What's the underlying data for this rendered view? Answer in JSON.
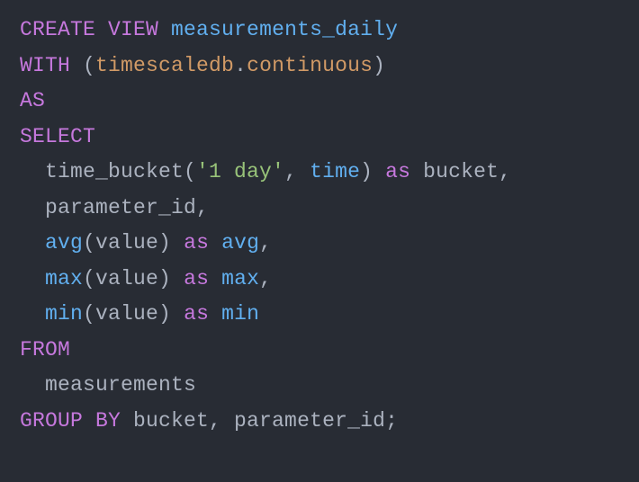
{
  "code": {
    "lines": [
      [
        {
          "t": "CREATE VIEW",
          "c": "kw"
        },
        {
          "t": " ",
          "c": "plain"
        },
        {
          "t": "measurements_daily",
          "c": "ident"
        }
      ],
      [
        {
          "t": "WITH",
          "c": "kw"
        },
        {
          "t": " (",
          "c": "plain"
        },
        {
          "t": "timescaledb",
          "c": "attr"
        },
        {
          "t": ".",
          "c": "plain"
        },
        {
          "t": "continuous",
          "c": "attr"
        },
        {
          "t": ")",
          "c": "plain"
        }
      ],
      [
        {
          "t": "AS",
          "c": "kw"
        }
      ],
      [
        {
          "t": "SELECT",
          "c": "kw"
        }
      ],
      [
        {
          "t": "  time_bucket(",
          "c": "plain"
        },
        {
          "t": "'1 day'",
          "c": "str"
        },
        {
          "t": ", ",
          "c": "plain"
        },
        {
          "t": "time",
          "c": "ident"
        },
        {
          "t": ") ",
          "c": "plain"
        },
        {
          "t": "as",
          "c": "kw"
        },
        {
          "t": " bucket,",
          "c": "plain"
        }
      ],
      [
        {
          "t": "  parameter_id,",
          "c": "plain"
        }
      ],
      [
        {
          "t": "  ",
          "c": "plain"
        },
        {
          "t": "avg",
          "c": "ident"
        },
        {
          "t": "(value) ",
          "c": "plain"
        },
        {
          "t": "as",
          "c": "kw"
        },
        {
          "t": " ",
          "c": "plain"
        },
        {
          "t": "avg",
          "c": "ident"
        },
        {
          "t": ",",
          "c": "plain"
        }
      ],
      [
        {
          "t": "  ",
          "c": "plain"
        },
        {
          "t": "max",
          "c": "ident"
        },
        {
          "t": "(value) ",
          "c": "plain"
        },
        {
          "t": "as",
          "c": "kw"
        },
        {
          "t": " ",
          "c": "plain"
        },
        {
          "t": "max",
          "c": "ident"
        },
        {
          "t": ",",
          "c": "plain"
        }
      ],
      [
        {
          "t": "  ",
          "c": "plain"
        },
        {
          "t": "min",
          "c": "ident"
        },
        {
          "t": "(value) ",
          "c": "plain"
        },
        {
          "t": "as",
          "c": "kw"
        },
        {
          "t": " ",
          "c": "plain"
        },
        {
          "t": "min",
          "c": "ident"
        }
      ],
      [
        {
          "t": "FROM",
          "c": "kw"
        }
      ],
      [
        {
          "t": "  measurements",
          "c": "plain"
        }
      ],
      [
        {
          "t": "GROUP BY",
          "c": "kw"
        },
        {
          "t": " bucket, parameter_id;",
          "c": "plain"
        }
      ]
    ]
  }
}
